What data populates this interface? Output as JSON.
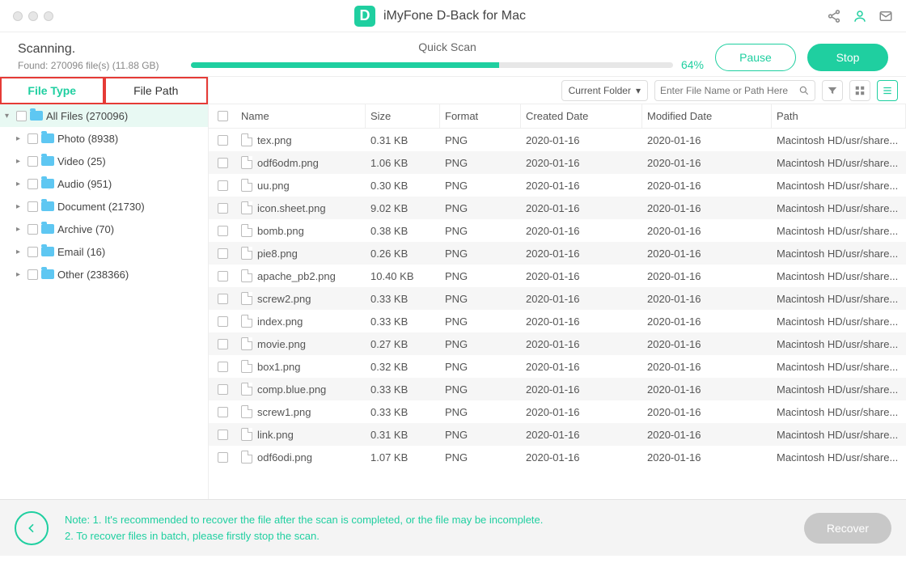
{
  "title": {
    "app_name": "iMyFone D-Back for Mac",
    "logo_letter": "D"
  },
  "scan": {
    "status_label": "Scanning.",
    "found_label": "Found: 270096 file(s) (11.88 GB)",
    "mode_label": "Quick Scan",
    "percent_label": "64%",
    "pause_label": "Pause",
    "stop_label": "Stop"
  },
  "sidebar": {
    "tab_file_type": "File Type",
    "tab_file_path": "File Path",
    "root_label": "All Files (270096)",
    "items": [
      {
        "label": "Photo (8938)"
      },
      {
        "label": "Video (25)"
      },
      {
        "label": "Audio (951)"
      },
      {
        "label": "Document (21730)"
      },
      {
        "label": "Archive (70)"
      },
      {
        "label": "Email (16)"
      },
      {
        "label": "Other (238366)"
      }
    ]
  },
  "toolbar": {
    "folder_scope": "Current Folder",
    "search_placeholder": "Enter File Name or Path Here"
  },
  "table": {
    "headers": {
      "name": "Name",
      "size": "Size",
      "format": "Format",
      "created": "Created Date",
      "modified": "Modified Date",
      "path": "Path"
    },
    "rows": [
      {
        "name": "tex.png",
        "size": "0.31 KB",
        "format": "PNG",
        "created": "2020-01-16",
        "modified": "2020-01-16",
        "path": "Macintosh HD/usr/share..."
      },
      {
        "name": "odf6odm.png",
        "size": "1.06 KB",
        "format": "PNG",
        "created": "2020-01-16",
        "modified": "2020-01-16",
        "path": "Macintosh HD/usr/share..."
      },
      {
        "name": "uu.png",
        "size": "0.30 KB",
        "format": "PNG",
        "created": "2020-01-16",
        "modified": "2020-01-16",
        "path": "Macintosh HD/usr/share..."
      },
      {
        "name": "icon.sheet.png",
        "size": "9.02 KB",
        "format": "PNG",
        "created": "2020-01-16",
        "modified": "2020-01-16",
        "path": "Macintosh HD/usr/share..."
      },
      {
        "name": "bomb.png",
        "size": "0.38 KB",
        "format": "PNG",
        "created": "2020-01-16",
        "modified": "2020-01-16",
        "path": "Macintosh HD/usr/share..."
      },
      {
        "name": "pie8.png",
        "size": "0.26 KB",
        "format": "PNG",
        "created": "2020-01-16",
        "modified": "2020-01-16",
        "path": "Macintosh HD/usr/share..."
      },
      {
        "name": "apache_pb2.png",
        "size": "10.40 KB",
        "format": "PNG",
        "created": "2020-01-16",
        "modified": "2020-01-16",
        "path": "Macintosh HD/usr/share..."
      },
      {
        "name": "screw2.png",
        "size": "0.33 KB",
        "format": "PNG",
        "created": "2020-01-16",
        "modified": "2020-01-16",
        "path": "Macintosh HD/usr/share..."
      },
      {
        "name": "index.png",
        "size": "0.33 KB",
        "format": "PNG",
        "created": "2020-01-16",
        "modified": "2020-01-16",
        "path": "Macintosh HD/usr/share..."
      },
      {
        "name": "movie.png",
        "size": "0.27 KB",
        "format": "PNG",
        "created": "2020-01-16",
        "modified": "2020-01-16",
        "path": "Macintosh HD/usr/share..."
      },
      {
        "name": "box1.png",
        "size": "0.32 KB",
        "format": "PNG",
        "created": "2020-01-16",
        "modified": "2020-01-16",
        "path": "Macintosh HD/usr/share..."
      },
      {
        "name": "comp.blue.png",
        "size": "0.33 KB",
        "format": "PNG",
        "created": "2020-01-16",
        "modified": "2020-01-16",
        "path": "Macintosh HD/usr/share..."
      },
      {
        "name": "screw1.png",
        "size": "0.33 KB",
        "format": "PNG",
        "created": "2020-01-16",
        "modified": "2020-01-16",
        "path": "Macintosh HD/usr/share..."
      },
      {
        "name": "link.png",
        "size": "0.31 KB",
        "format": "PNG",
        "created": "2020-01-16",
        "modified": "2020-01-16",
        "path": "Macintosh HD/usr/share..."
      },
      {
        "name": "odf6odi.png",
        "size": "1.07 KB",
        "format": "PNG",
        "created": "2020-01-16",
        "modified": "2020-01-16",
        "path": "Macintosh HD/usr/share..."
      }
    ]
  },
  "footer": {
    "note_line1": "Note: 1. It's recommended to recover the file after the scan is completed, or the file may be incomplete.",
    "note_line2": "2. To recover files in batch, please firstly stop the scan.",
    "recover_label": "Recover"
  }
}
